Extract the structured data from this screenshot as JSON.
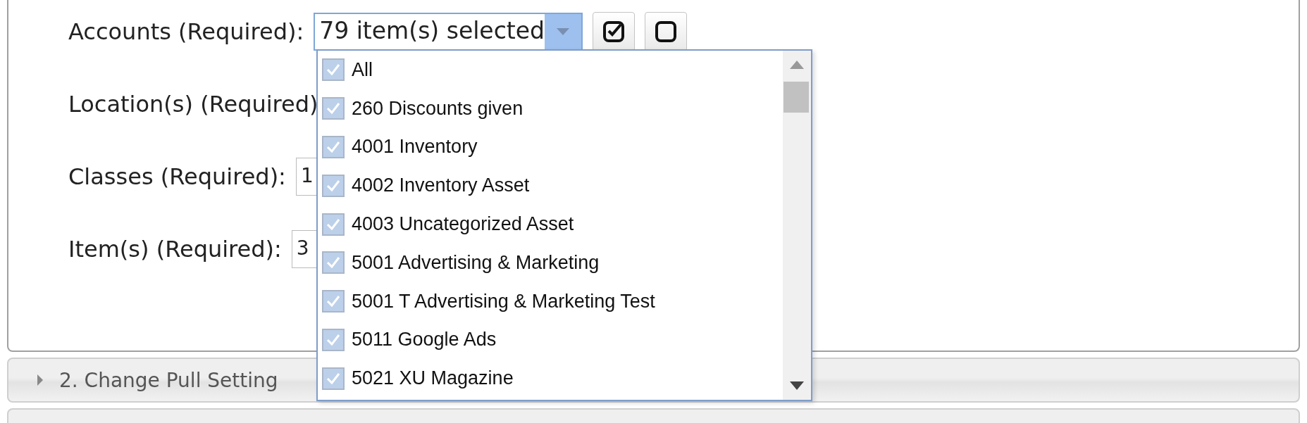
{
  "form": {
    "fields": [
      {
        "kind": "multiselect",
        "label": "Accounts (Required):",
        "value": "79 item(s) selected",
        "open": true
      },
      {
        "kind": "label",
        "label": "Location(s) (Required)"
      },
      {
        "kind": "text",
        "label": "Classes (Required):",
        "value": "1"
      },
      {
        "kind": "text",
        "label": "Item(s) (Required):",
        "value": "3"
      }
    ]
  },
  "dropdown": {
    "items": [
      {
        "label": "All",
        "checked": true
      },
      {
        "label": "260 Discounts given",
        "checked": true
      },
      {
        "label": "4001 Inventory",
        "checked": true
      },
      {
        "label": "4002 Inventory Asset",
        "checked": true
      },
      {
        "label": "4003 Uncategorized Asset",
        "checked": true
      },
      {
        "label": "5001 Advertising & Marketing",
        "checked": true
      },
      {
        "label": "5001 T Advertising & Marketing Test",
        "checked": true
      },
      {
        "label": "5011 Google Ads",
        "checked": true
      },
      {
        "label": "5021 XU Magazine",
        "checked": true
      }
    ]
  },
  "sections": [
    {
      "title": "2. Change Pull Setting",
      "expanded": false
    }
  ]
}
